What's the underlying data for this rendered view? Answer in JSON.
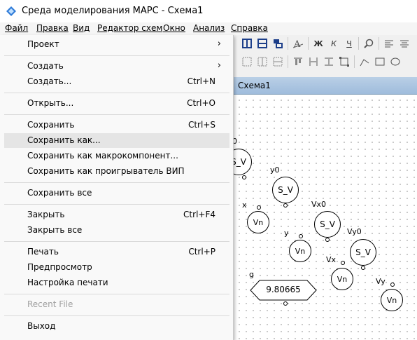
{
  "window": {
    "title": "Среда моделирования МАРС - Схема1"
  },
  "menubar": [
    "Файл",
    "Правка",
    "Вид",
    "Редактор схем",
    "Окно",
    "Анализ",
    "Справка"
  ],
  "toolbar": {
    "icons": [
      "layout-a",
      "layout-b",
      "layout-c",
      "font",
      "bold",
      "italic",
      "underline",
      "search",
      "align-left",
      "align-center"
    ]
  },
  "document": {
    "tab": "Схема1"
  },
  "diagram": {
    "blocks": [
      {
        "kind": "S_V",
        "text": "S_V",
        "label": "0"
      },
      {
        "kind": "S_V",
        "text": "S_V",
        "label": "y0"
      },
      {
        "kind": "Vn",
        "text": "Vn",
        "label": "x"
      },
      {
        "kind": "S_V",
        "text": "S_V",
        "label": "Vx0"
      },
      {
        "kind": "Vn",
        "text": "Vn",
        "label": "y"
      },
      {
        "kind": "S_V",
        "text": "S_V",
        "label": "Vy0"
      },
      {
        "kind": "Vn",
        "text": "Vn",
        "label": "Vx"
      },
      {
        "kind": "Vn",
        "text": "Vn",
        "label": "Vy"
      },
      {
        "kind": "const",
        "text": "9.80665",
        "label": "g"
      }
    ]
  },
  "file_menu": {
    "items": [
      {
        "label": "Проект",
        "shortcut": "",
        "submenu": true
      },
      {
        "sep": true
      },
      {
        "label": "Создать",
        "shortcut": "",
        "submenu": true
      },
      {
        "label": "Создать...",
        "shortcut": "Ctrl+N"
      },
      {
        "sep": true
      },
      {
        "label": "Открыть...",
        "shortcut": "Ctrl+O"
      },
      {
        "sep": true
      },
      {
        "label": "Сохранить",
        "shortcut": "Ctrl+S"
      },
      {
        "label": "Сохранить как...",
        "shortcut": "",
        "highlighted": true
      },
      {
        "label": "Сохранить как макрокомпонент...",
        "shortcut": ""
      },
      {
        "label": "Сохранить как проигрыватель ВИП",
        "shortcut": ""
      },
      {
        "sep": true
      },
      {
        "label": "Сохранить все",
        "shortcut": ""
      },
      {
        "sep": true
      },
      {
        "label": "Закрыть",
        "shortcut": "Ctrl+F4"
      },
      {
        "label": "Закрыть все",
        "shortcut": ""
      },
      {
        "sep": true
      },
      {
        "label": "Печать",
        "shortcut": "Ctrl+P"
      },
      {
        "label": "Предпросмотр",
        "shortcut": ""
      },
      {
        "label": "Настройка печати",
        "shortcut": ""
      },
      {
        "sep": true
      },
      {
        "label": "Recent File",
        "shortcut": "",
        "disabled": true
      },
      {
        "sep": true
      },
      {
        "label": "Выход",
        "shortcut": ""
      }
    ]
  }
}
